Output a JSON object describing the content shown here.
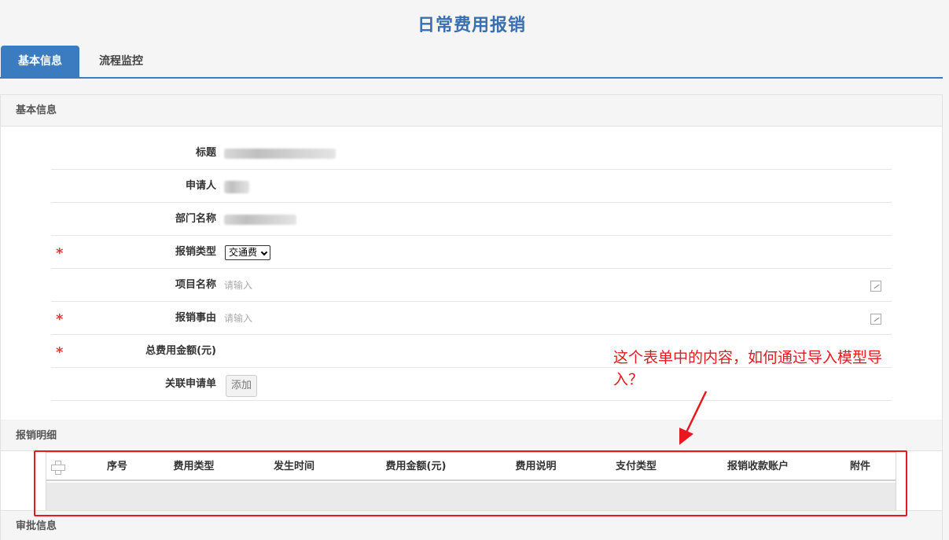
{
  "page": {
    "title": "日常费用报销"
  },
  "tabs": [
    {
      "label": "基本信息",
      "active": true
    },
    {
      "label": "流程监控",
      "active": false
    }
  ],
  "sections": {
    "basic": "基本信息",
    "detail": "报销明细",
    "approval": "审批信息"
  },
  "form": {
    "title_label": "标题",
    "applicant_label": "申请人",
    "department_label": "部门名称",
    "reimburse_type_label": "报销类型",
    "reimburse_type_value": "交通费",
    "project_label": "项目名称",
    "project_placeholder": "请输入",
    "reason_label": "报销事由",
    "reason_placeholder": "请输入",
    "total_label": "总费用金额(元)",
    "related_label": "关联申请单",
    "add_button": "添加",
    "required_mark": "*"
  },
  "detail_table": {
    "columns": [
      "序号",
      "费用类型",
      "发生时间",
      "费用金额(元)",
      "费用说明",
      "支付类型",
      "报销收款账户",
      "附件"
    ],
    "rows": []
  },
  "annotation": {
    "text": "这个表单中的内容，如何通过导入模型导入？",
    "color": "#e8191e"
  },
  "colors": {
    "accent": "#3b7bbf",
    "title": "#3a6fb0",
    "required": "#e03a3a"
  }
}
